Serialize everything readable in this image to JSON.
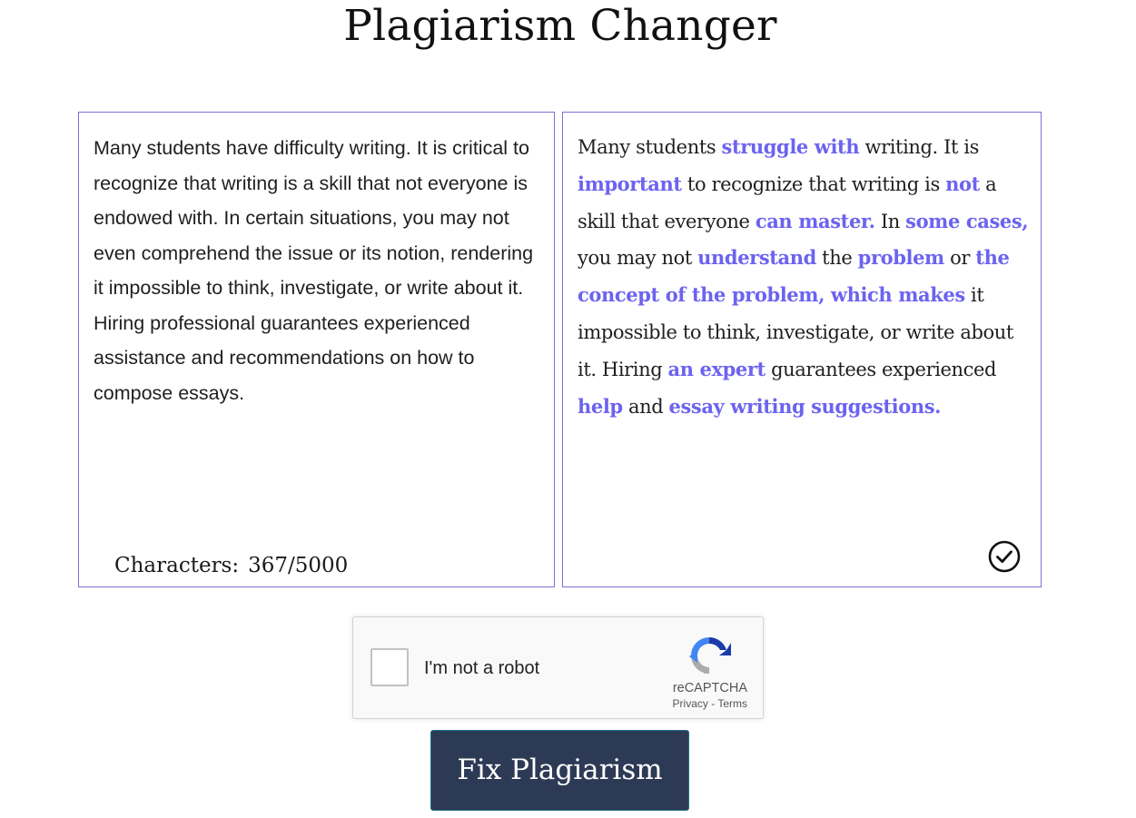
{
  "page": {
    "title": "Plagiarism Changer"
  },
  "input": {
    "text": "Many students have difficulty writing. It is critical to recognize that writing is a skill that not everyone is endowed with. In certain situations, you may not even comprehend the issue or its notion, rendering it impossible to think, investigate, or write about it. Hiring professional guarantees experienced assistance and recommendations on how to compose essays.",
    "char_count_label": "Characters:",
    "char_count_value": "367/5000"
  },
  "output": {
    "segments": [
      {
        "text": "Many students ",
        "changed": false
      },
      {
        "text": "struggle with",
        "changed": true
      },
      {
        "text": " writing. It is ",
        "changed": false
      },
      {
        "text": "important",
        "changed": true
      },
      {
        "text": " to recognize that writing is ",
        "changed": false
      },
      {
        "text": "not",
        "changed": true
      },
      {
        "text": " a skill that everyone ",
        "changed": false
      },
      {
        "text": "can master.",
        "changed": true
      },
      {
        "text": " In ",
        "changed": false
      },
      {
        "text": "some cases,",
        "changed": true
      },
      {
        "text": " you may not ",
        "changed": false
      },
      {
        "text": "understand",
        "changed": true
      },
      {
        "text": " the ",
        "changed": false
      },
      {
        "text": "problem",
        "changed": true
      },
      {
        "text": " or ",
        "changed": false
      },
      {
        "text": "the concept of the problem, which makes",
        "changed": true
      },
      {
        "text": " it impossible to think, investigate, or write about it. Hiring ",
        "changed": false
      },
      {
        "text": "an expert",
        "changed": true
      },
      {
        "text": " guarantees experienced ",
        "changed": false
      },
      {
        "text": "help",
        "changed": true
      },
      {
        "text": " and ",
        "changed": false
      },
      {
        "text": "essay writing suggestions.",
        "changed": true
      }
    ],
    "status_icon": "check-circle-icon",
    "highlight_color": "#6c63ef"
  },
  "captcha": {
    "label": "I'm not a robot",
    "brand": "reCAPTCHA",
    "privacy": "Privacy",
    "separator": " - ",
    "terms": "Terms",
    "checked": false
  },
  "actions": {
    "fix_label": "Fix Plagiarism",
    "button_color": "#2d3a55"
  }
}
